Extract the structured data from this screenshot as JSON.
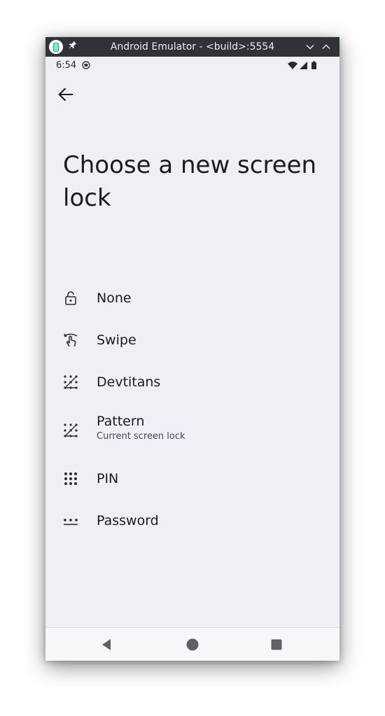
{
  "window": {
    "title": "Android Emulator - <build>:5554"
  },
  "status_bar": {
    "time": "6:54"
  },
  "page": {
    "title": "Choose a new screen lock"
  },
  "options": [
    {
      "label": "None",
      "icon": "lock-open-icon"
    },
    {
      "label": "Swipe",
      "icon": "swipe-icon"
    },
    {
      "label": "Devtitans",
      "icon": "pattern-icon"
    },
    {
      "label": "Pattern",
      "subtitle": "Current screen lock",
      "icon": "pattern-icon"
    },
    {
      "label": "PIN",
      "icon": "pin-grid-icon"
    },
    {
      "label": "Password",
      "icon": "password-icon"
    }
  ],
  "colors": {
    "titlebar": "#2f3336",
    "background": "#efeff5",
    "text": "#1b1b1f",
    "navbar_icon": "#5f5f66"
  }
}
